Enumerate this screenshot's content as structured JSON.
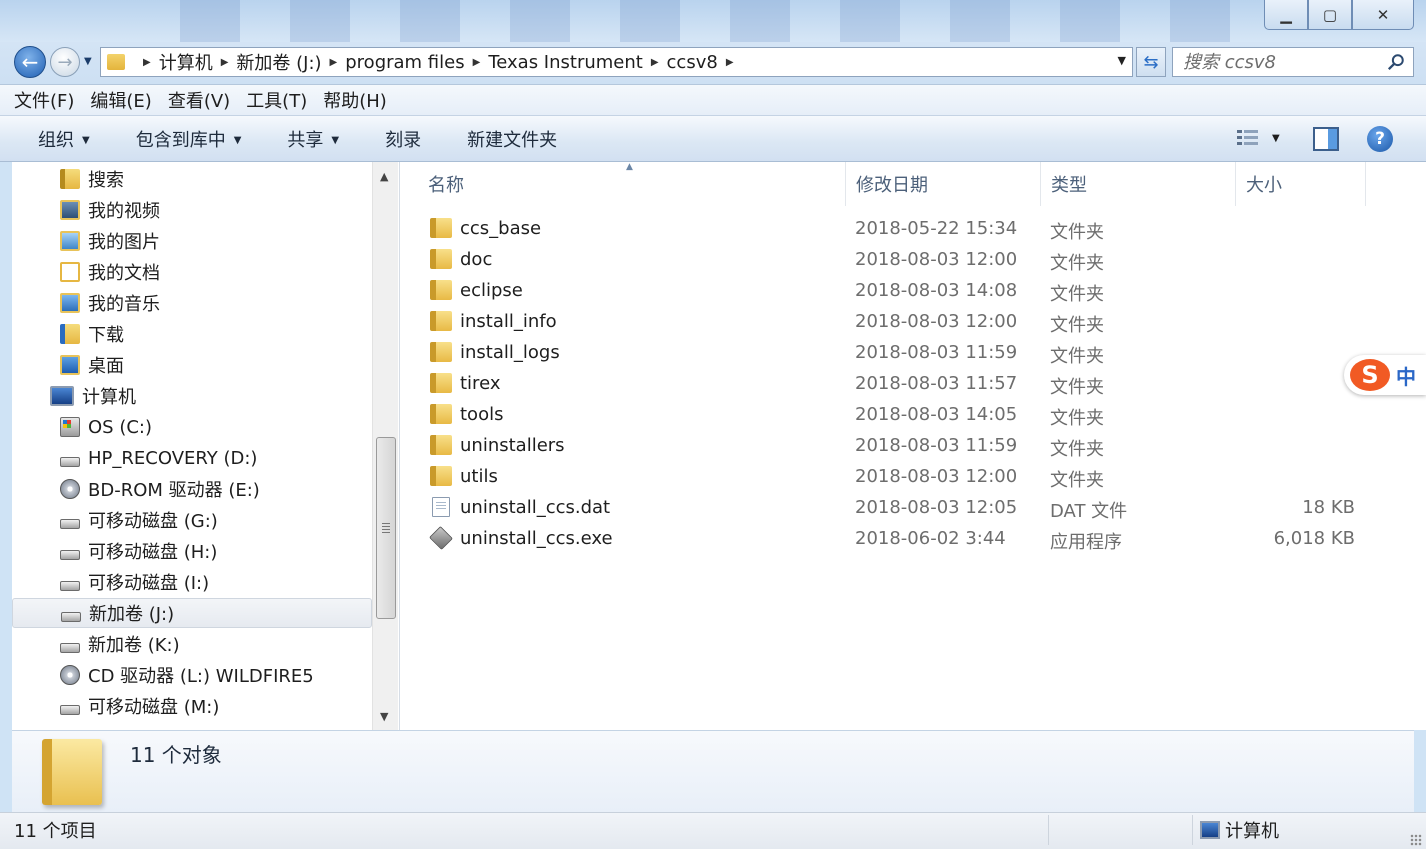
{
  "window": {
    "minimize_glyph": "▁",
    "maximize_glyph": "▢",
    "close_glyph": "✕"
  },
  "nav": {
    "back_glyph": "←",
    "forward_glyph": "→",
    "refresh_glyph": "⇆"
  },
  "address": {
    "crumbs": [
      "计算机",
      "新加卷 (J:)",
      "program files",
      "Texas Instrument",
      "ccsv8"
    ]
  },
  "search": {
    "placeholder": "搜索 ccsv8"
  },
  "menu": [
    "文件(F)",
    "编辑(E)",
    "查看(V)",
    "工具(T)",
    "帮助(H)"
  ],
  "commands": [
    {
      "label": "组织",
      "dropdown": true
    },
    {
      "label": "包含到库中",
      "dropdown": true
    },
    {
      "label": "共享",
      "dropdown": true
    },
    {
      "label": "刻录",
      "dropdown": false
    },
    {
      "label": "新建文件夹",
      "dropdown": false
    }
  ],
  "help_glyph": "?",
  "navpane": {
    "items": [
      {
        "label": "搜索",
        "icon": "library-folder-icon",
        "indent": 2
      },
      {
        "label": "我的视频",
        "icon": "video-icon",
        "indent": 2
      },
      {
        "label": "我的图片",
        "icon": "pictures-icon",
        "indent": 2
      },
      {
        "label": "我的文档",
        "icon": "documents-icon",
        "indent": 2
      },
      {
        "label": "我的音乐",
        "icon": "music-icon",
        "indent": 2
      },
      {
        "label": "下载",
        "icon": "download-icon",
        "indent": 2
      },
      {
        "label": "桌面",
        "icon": "desktop-icon",
        "indent": 2
      },
      {
        "label": "计算机",
        "icon": "computer-icon",
        "indent": 1
      },
      {
        "label": "OS (C:)",
        "icon": "os-drive-icon",
        "indent": 2
      },
      {
        "label": "HP_RECOVERY (D:)",
        "icon": "drive-icon",
        "indent": 2
      },
      {
        "label": "BD-ROM 驱动器 (E:)",
        "icon": "disc-drive-icon",
        "indent": 2
      },
      {
        "label": "可移动磁盘 (G:)",
        "icon": "removable-drive-icon",
        "indent": 2
      },
      {
        "label": "可移动磁盘 (H:)",
        "icon": "removable-drive-icon",
        "indent": 2
      },
      {
        "label": "可移动磁盘 (I:)",
        "icon": "removable-drive-icon",
        "indent": 2
      },
      {
        "label": "新加卷 (J:)",
        "icon": "drive-icon",
        "indent": 2,
        "selected": true
      },
      {
        "label": "新加卷 (K:)",
        "icon": "drive-icon",
        "indent": 2
      },
      {
        "label": "CD 驱动器 (L:) WILDFIRE5",
        "icon": "cd-drive-icon",
        "indent": 2
      },
      {
        "label": "可移动磁盘 (M:)",
        "icon": "removable-drive-icon",
        "indent": 2
      }
    ]
  },
  "columns": [
    {
      "key": "name",
      "label": "名称"
    },
    {
      "key": "date",
      "label": "修改日期"
    },
    {
      "key": "type",
      "label": "类型"
    },
    {
      "key": "size",
      "label": "大小"
    }
  ],
  "files": [
    {
      "name": "ccs_base",
      "date": "2018-05-22 15:34",
      "type": "文件夹",
      "size": "",
      "icon": "folder-icon"
    },
    {
      "name": "doc",
      "date": "2018-08-03 12:00",
      "type": "文件夹",
      "size": "",
      "icon": "folder-icon"
    },
    {
      "name": "eclipse",
      "date": "2018-08-03 14:08",
      "type": "文件夹",
      "size": "",
      "icon": "folder-icon"
    },
    {
      "name": "install_info",
      "date": "2018-08-03 12:00",
      "type": "文件夹",
      "size": "",
      "icon": "folder-icon"
    },
    {
      "name": "install_logs",
      "date": "2018-08-03 11:59",
      "type": "文件夹",
      "size": "",
      "icon": "folder-icon"
    },
    {
      "name": "tirex",
      "date": "2018-08-03 11:57",
      "type": "文件夹",
      "size": "",
      "icon": "folder-icon"
    },
    {
      "name": "tools",
      "date": "2018-08-03 14:05",
      "type": "文件夹",
      "size": "",
      "icon": "folder-icon"
    },
    {
      "name": "uninstallers",
      "date": "2018-08-03 11:59",
      "type": "文件夹",
      "size": "",
      "icon": "folder-icon"
    },
    {
      "name": "utils",
      "date": "2018-08-03 12:00",
      "type": "文件夹",
      "size": "",
      "icon": "folder-icon"
    },
    {
      "name": "uninstall_ccs.dat",
      "date": "2018-08-03 12:05",
      "type": "DAT 文件",
      "size": "18 KB",
      "icon": "dat-file-icon"
    },
    {
      "name": "uninstall_ccs.exe",
      "date": "2018-06-02 3:44",
      "type": "应用程序",
      "size": "6,018 KB",
      "icon": "exe-file-icon"
    }
  ],
  "details": {
    "summary": "11 个对象"
  },
  "status": {
    "left": "11 个项目",
    "right": "计算机"
  },
  "ime": {
    "logo": "S",
    "mode": "中"
  }
}
